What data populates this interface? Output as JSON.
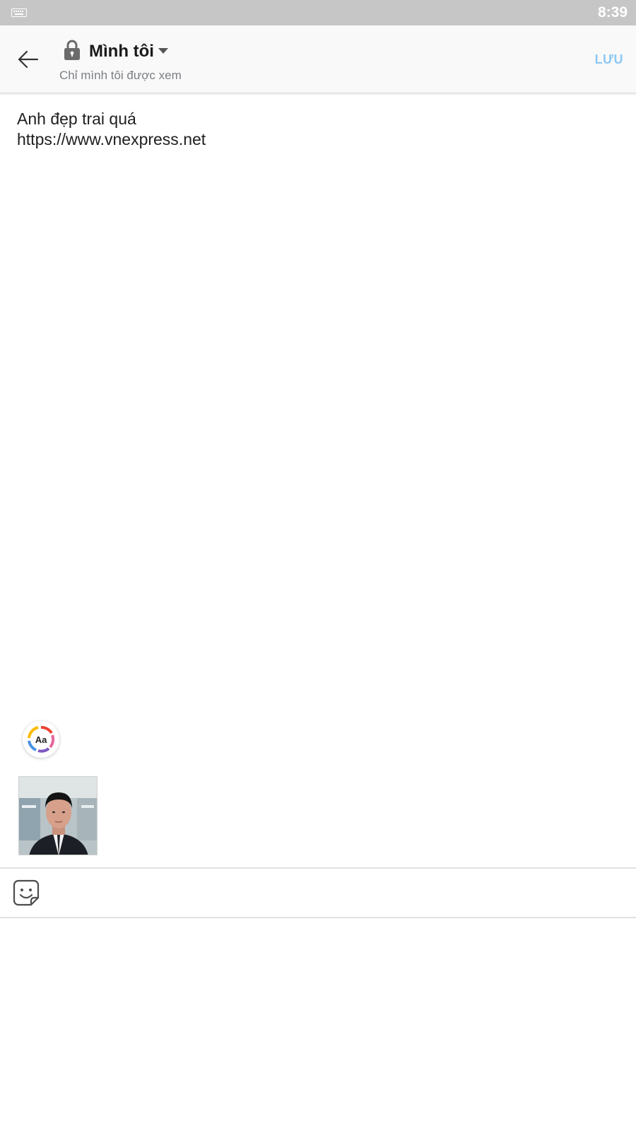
{
  "status_bar": {
    "time": "8:39",
    "keyboard_icon": "keyboard-icon"
  },
  "header": {
    "back_icon": "arrow-left-icon",
    "privacy": {
      "icon": "lock-icon",
      "title": "Mình tôi",
      "subtitle": "Chỉ mình tôi được xem",
      "dropdown_icon": "caret-down-icon"
    },
    "save_label": "LƯU"
  },
  "note": {
    "lines": [
      "Anh đẹp trai quá",
      "https://www.vnexpress.net"
    ]
  },
  "toolbar": {
    "text_style_label": "Aa",
    "sticker_icon": "sticker-face-icon"
  },
  "attachments": [
    {
      "type": "photo",
      "subject": "portrait"
    }
  ],
  "colors": {
    "status_bar": "#c6c6c6",
    "accent_save": "#8cc8f4",
    "subtitle": "#7c7f84",
    "divider": "#e1e1e1"
  }
}
